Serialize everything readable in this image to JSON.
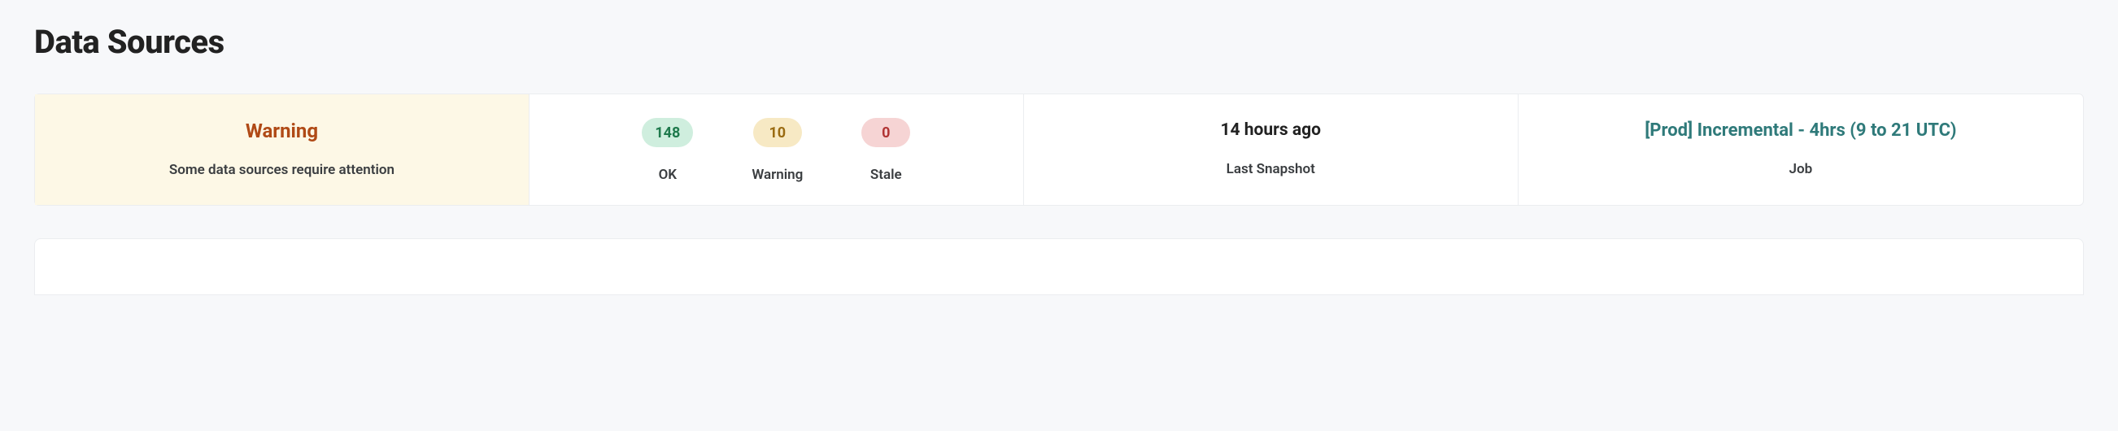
{
  "page": {
    "title": "Data Sources"
  },
  "statusCard": {
    "title": "Warning",
    "subtitle": "Some data sources require attention"
  },
  "counts": {
    "ok": {
      "value": "148",
      "label": "OK"
    },
    "warning": {
      "value": "10",
      "label": "Warning"
    },
    "stale": {
      "value": "0",
      "label": "Stale"
    }
  },
  "snapshot": {
    "value": "14 hours ago",
    "label": "Last Snapshot"
  },
  "job": {
    "value": "[Prod] Incremental - 4hrs (9 to 21 UTC)",
    "label": "Job"
  }
}
